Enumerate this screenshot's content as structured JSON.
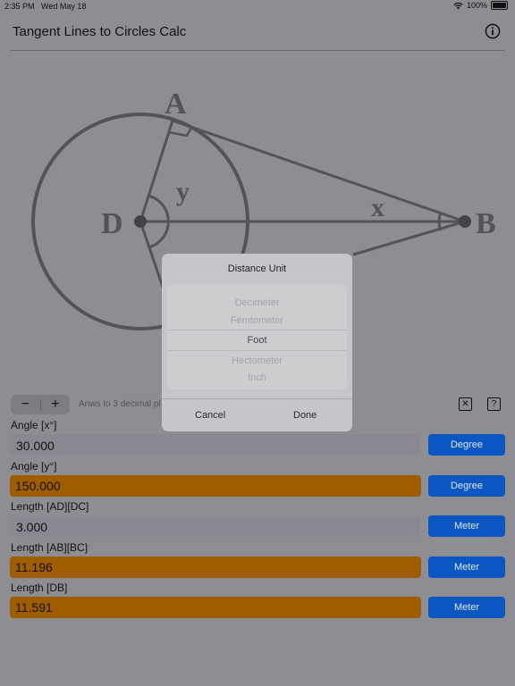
{
  "status": {
    "time": "2:35 PM",
    "date": "Wed May 18",
    "battery": "100%"
  },
  "nav": {
    "title": "Tangent Lines to Circles Calc",
    "info_icon": "info-circle-icon"
  },
  "diagram": {
    "labels": {
      "A": "A",
      "B": "B",
      "D": "D",
      "x": "x",
      "y": "y"
    }
  },
  "toolbar": {
    "minus": "−",
    "plus": "+",
    "precision_text": "Anws to 3 decimal pl",
    "clear_icon": "x-box-icon",
    "help_icon": "question-box-icon",
    "clear_glyph": "✕",
    "help_glyph": "?"
  },
  "fields": [
    {
      "label": "Angle [x°]",
      "value": "30.000",
      "unit": "Degree",
      "kind": "input"
    },
    {
      "label": "Angle [y°]",
      "value": "150.000",
      "unit": "Degree",
      "kind": "result"
    },
    {
      "label": "Length [AD][DC]",
      "value": "3.000",
      "unit": "Meter",
      "kind": "input"
    },
    {
      "label": "Length [AB][BC]",
      "value": "11.196",
      "unit": "Meter",
      "kind": "result"
    },
    {
      "label": "Length [DB]",
      "value": "11.591",
      "unit": "Meter",
      "kind": "result"
    }
  ],
  "dialog": {
    "title": "Distance Unit",
    "options": [
      "Decimeter",
      "Femtometer",
      "Foot",
      "Hectometer",
      "Inch"
    ],
    "selected": "Foot",
    "cancel": "Cancel",
    "done": "Done"
  },
  "colors": {
    "result": "#a05d00",
    "unit_button": "#0a56c2",
    "overlay": "#8e8d92"
  }
}
